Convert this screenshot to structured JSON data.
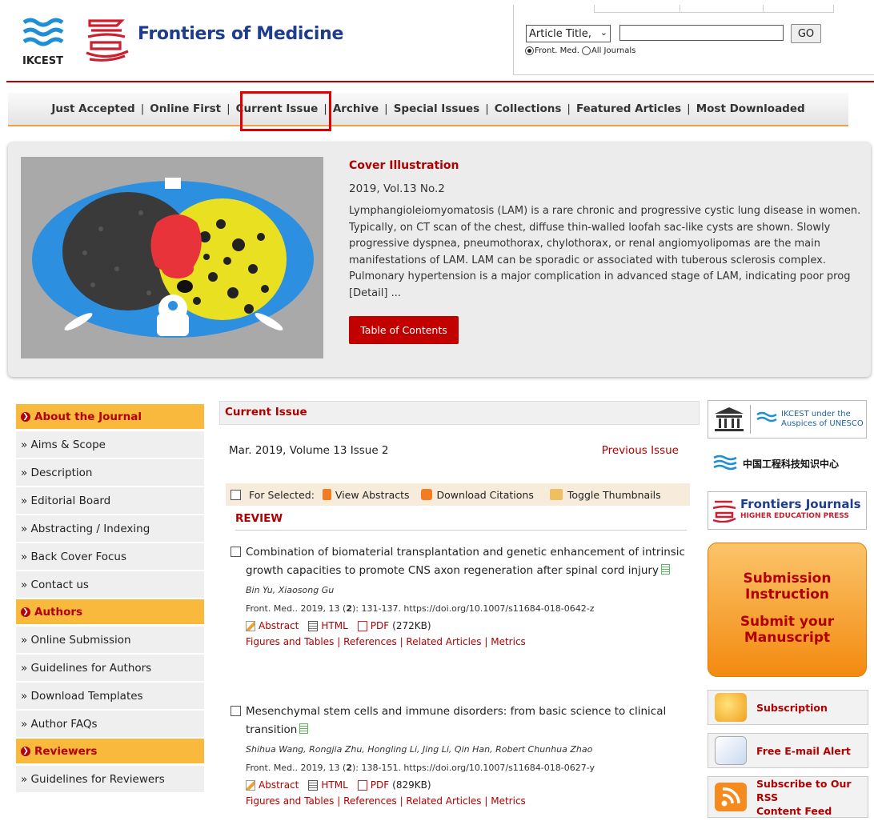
{
  "header": {
    "ikcest_logo_text": "IKCEST",
    "journal_title": "Frontiers of Medicine"
  },
  "search": {
    "field_select": "Article Title,",
    "input_value": "",
    "go_label": "GO",
    "scope_options": [
      "Front. Med.",
      "All Journals"
    ],
    "scope_selected": "Front. Med."
  },
  "nav": {
    "items": [
      "Just Accepted",
      "Online First",
      "Current Issue",
      "Archive",
      "Special Issues",
      "Collections",
      "Featured Articles",
      "Most Downloaded"
    ],
    "highlighted": "Current Issue"
  },
  "cover": {
    "title": "Cover Illustration",
    "issue": "2019, Vol.13  No.2",
    "text": "Lymphangioleiomyomatosis (LAM) is a rare chronic and progressive cystic lung disease in women. Typically, on CT scan of the chest, diffuse thin-walled loofah sac-like cysts are shown. Slowly progressive dyspnea, pneumothorax, chylothorax, or renal angiomyolipomas are the main manifestations of LAM. LAM can be sporadic or associated with tuberous sclerosis complex. Pulmonary hypertension is a major complication in advanced stage of LAM, indicating poor prog [Detail] ...",
    "toc_button": "Table of Contents"
  },
  "sidebar": {
    "sections": [
      {
        "title": "About the Journal",
        "items": [
          "» Aims & Scope",
          "» Description",
          "» Editorial Board",
          "» Abstracting / Indexing",
          "» Back Cover Focus",
          "» Contact us"
        ]
      },
      {
        "title": "Authors",
        "items": [
          "» Online Submission",
          "» Guidelines for Authors",
          "» Download Templates",
          "» Author FAQs"
        ]
      },
      {
        "title": "Reviewers",
        "items": [
          "» Guidelines for Reviewers"
        ]
      }
    ]
  },
  "main": {
    "heading": "Current Issue",
    "issue_line": "Mar. 2019, Volume 13 Issue 2",
    "previous_issue": "Previous Issue",
    "for_selected": "For Selected:",
    "view_abstracts": "View Abstracts",
    "download_citations": "Download Citations",
    "toggle_thumbnails": "Toggle Thumbnails",
    "section": "REVIEW",
    "articles": [
      {
        "title": "Combination of biomaterial transplantation and genetic enhancement of intrinsic growth capacities to promote CNS axon regeneration after spinal cord injury",
        "authors": "Bin Yu, Xiaosong Gu",
        "cite_prefix": "Front. Med.. 2019, 13 (",
        "cite_issue": "2",
        "cite_suffix": "): 131-137.  https://doi.org/10.1007/s11684-018-0642-z",
        "abstract": "Abstract",
        "html": "HTML",
        "pdf": "PDF",
        "pdf_size": "(272KB)",
        "figures": "Figures and Tables",
        "references": "References",
        "related": "Related Articles",
        "metrics": "Metrics"
      },
      {
        "title": "Mesenchymal stem cells and immune disorders: from basic science to clinical transition",
        "authors": "Shihua Wang, Rongjia Zhu, Hongling Li, Jing Li, Qin Han, Robert Chunhua Zhao",
        "cite_prefix": "Front. Med.. 2019, 13 (",
        "cite_issue": "2",
        "cite_suffix": "): 138-151.  https://doi.org/10.1007/s11684-018-0627-y",
        "abstract": "Abstract",
        "html": "HTML",
        "pdf": "PDF",
        "pdf_size": "(829KB)",
        "figures": "Figures and Tables",
        "references": "References",
        "related": "Related Articles",
        "metrics": "Metrics"
      }
    ]
  },
  "right": {
    "unesco_text": "IKCEST under the Auspices of UNESCO",
    "ikcest_cn": "中国工程科技知识中心",
    "frontiers_journals": "Frontiers Journals",
    "hep": "HIGHER EDUCATION PRESS",
    "submission_line1": "Submission",
    "submission_line2": "Instruction",
    "submission_line3": "Submit your",
    "submission_line4": "Manuscript",
    "subscription": "Subscription",
    "email_alert": "Free E-mail Alert",
    "rss_line1": "Subscribe to Our RSS",
    "rss_line2": "Content Feed"
  },
  "colors": {
    "brand_red": "#b00000",
    "title_blue": "#1f3d8c",
    "sidebar_orange": "#f8b93c"
  }
}
